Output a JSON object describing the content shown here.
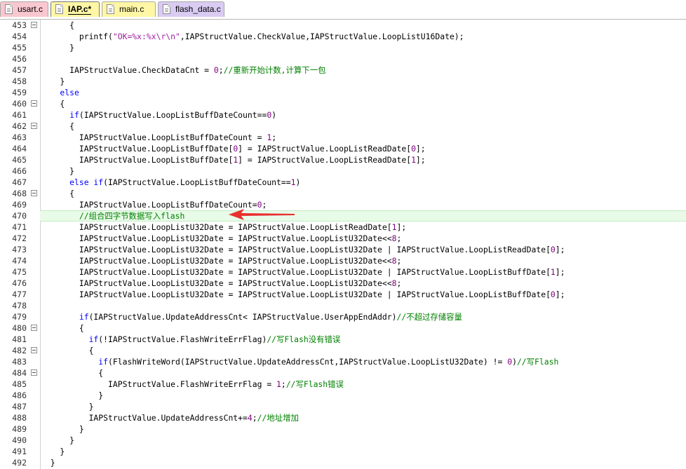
{
  "tabs": [
    {
      "label": "usart.c",
      "color": "#f9c7cf",
      "active": false
    },
    {
      "label": "IAP.c*",
      "color": "#fff6a6",
      "active": true
    },
    {
      "label": "main.c",
      "color": "#fff6a6",
      "active": false
    },
    {
      "label": "flash_data.c",
      "color": "#d9cbf2",
      "active": false
    }
  ],
  "lines": [
    {
      "num": "453",
      "fold": true,
      "code": [
        [
          "",
          "      {"
        ]
      ]
    },
    {
      "num": "454",
      "fold": false,
      "code": [
        [
          "",
          "        printf("
        ],
        [
          "str",
          "\"OK=%x:%x\\r\\n\""
        ],
        [
          "",
          ",IAPStructValue.CheckValue,IAPStructValue.LoopListU16Date);"
        ]
      ]
    },
    {
      "num": "455",
      "fold": false,
      "code": [
        [
          "",
          "      }"
        ]
      ]
    },
    {
      "num": "456",
      "fold": false,
      "code": []
    },
    {
      "num": "457",
      "fold": false,
      "code": [
        [
          "",
          "      IAPStructValue.CheckDataCnt = "
        ],
        [
          "num",
          "0"
        ],
        [
          "",
          ";"
        ],
        [
          "cm",
          "//重新开始计数,计算下一包"
        ]
      ]
    },
    {
      "num": "458",
      "fold": false,
      "code": [
        [
          "",
          "    }"
        ]
      ]
    },
    {
      "num": "459",
      "fold": false,
      "code": [
        [
          "kw",
          "    else"
        ]
      ]
    },
    {
      "num": "460",
      "fold": true,
      "code": [
        [
          "",
          "    {"
        ]
      ]
    },
    {
      "num": "461",
      "fold": false,
      "code": [
        [
          "kw",
          "      if"
        ],
        [
          "",
          "(IAPStructValue.LoopListBuffDateCount=="
        ],
        [
          "num",
          "0"
        ],
        [
          "",
          ")"
        ]
      ]
    },
    {
      "num": "462",
      "fold": true,
      "code": [
        [
          "",
          "      {"
        ]
      ]
    },
    {
      "num": "463",
      "fold": false,
      "code": [
        [
          "",
          "        IAPStructValue.LoopListBuffDateCount = "
        ],
        [
          "num",
          "1"
        ],
        [
          "",
          ";"
        ]
      ]
    },
    {
      "num": "464",
      "fold": false,
      "code": [
        [
          "",
          "        IAPStructValue.LoopListBuffDate["
        ],
        [
          "num",
          "0"
        ],
        [
          "",
          "] = IAPStructValue.LoopListReadDate["
        ],
        [
          "num",
          "0"
        ],
        [
          "",
          "];"
        ]
      ]
    },
    {
      "num": "465",
      "fold": false,
      "code": [
        [
          "",
          "        IAPStructValue.LoopListBuffDate["
        ],
        [
          "num",
          "1"
        ],
        [
          "",
          "] = IAPStructValue.LoopListReadDate["
        ],
        [
          "num",
          "1"
        ],
        [
          "",
          "];"
        ]
      ]
    },
    {
      "num": "466",
      "fold": false,
      "code": [
        [
          "",
          "      }"
        ]
      ]
    },
    {
      "num": "467",
      "fold": false,
      "code": [
        [
          "kw",
          "      else if"
        ],
        [
          "",
          "(IAPStructValue.LoopListBuffDateCount=="
        ],
        [
          "num",
          "1"
        ],
        [
          "",
          ")"
        ]
      ]
    },
    {
      "num": "468",
      "fold": true,
      "code": [
        [
          "",
          "      {"
        ]
      ]
    },
    {
      "num": "469",
      "fold": false,
      "code": [
        [
          "",
          "        IAPStructValue.LoopListBuffDateCount="
        ],
        [
          "num",
          "0"
        ],
        [
          "",
          ";"
        ]
      ]
    },
    {
      "num": "470",
      "fold": false,
      "hl": true,
      "code": [
        [
          "cm",
          "        //组合四字节数据写入flash"
        ]
      ]
    },
    {
      "num": "471",
      "fold": false,
      "code": [
        [
          "",
          "        IAPStructValue.LoopListU32Date = IAPStructValue.LoopListReadDate["
        ],
        [
          "num",
          "1"
        ],
        [
          "",
          "];"
        ]
      ]
    },
    {
      "num": "472",
      "fold": false,
      "code": [
        [
          "",
          "        IAPStructValue.LoopListU32Date = IAPStructValue.LoopListU32Date<<"
        ],
        [
          "num",
          "8"
        ],
        [
          "",
          ";"
        ]
      ]
    },
    {
      "num": "473",
      "fold": false,
      "code": [
        [
          "",
          "        IAPStructValue.LoopListU32Date = IAPStructValue.LoopListU32Date | IAPStructValue.LoopListReadDate["
        ],
        [
          "num",
          "0"
        ],
        [
          "",
          "];"
        ]
      ]
    },
    {
      "num": "474",
      "fold": false,
      "code": [
        [
          "",
          "        IAPStructValue.LoopListU32Date = IAPStructValue.LoopListU32Date<<"
        ],
        [
          "num",
          "8"
        ],
        [
          "",
          ";"
        ]
      ]
    },
    {
      "num": "475",
      "fold": false,
      "code": [
        [
          "",
          "        IAPStructValue.LoopListU32Date = IAPStructValue.LoopListU32Date | IAPStructValue.LoopListBuffDate["
        ],
        [
          "num",
          "1"
        ],
        [
          "",
          "];"
        ]
      ]
    },
    {
      "num": "476",
      "fold": false,
      "code": [
        [
          "",
          "        IAPStructValue.LoopListU32Date = IAPStructValue.LoopListU32Date<<"
        ],
        [
          "num",
          "8"
        ],
        [
          "",
          ";"
        ]
      ]
    },
    {
      "num": "477",
      "fold": false,
      "code": [
        [
          "",
          "        IAPStructValue.LoopListU32Date = IAPStructValue.LoopListU32Date | IAPStructValue.LoopListBuffDate["
        ],
        [
          "num",
          "0"
        ],
        [
          "",
          "];"
        ]
      ]
    },
    {
      "num": "478",
      "fold": false,
      "code": []
    },
    {
      "num": "479",
      "fold": false,
      "code": [
        [
          "kw",
          "        if"
        ],
        [
          "",
          "(IAPStructValue.UpdateAddressCnt< IAPStructValue.UserAppEndAddr)"
        ],
        [
          "cm",
          "//不超过存储容量"
        ]
      ]
    },
    {
      "num": "480",
      "fold": true,
      "code": [
        [
          "",
          "        {"
        ]
      ]
    },
    {
      "num": "481",
      "fold": false,
      "code": [
        [
          "kw",
          "          if"
        ],
        [
          "",
          "(!IAPStructValue.FlashWriteErrFlag)"
        ],
        [
          "cm",
          "//写Flash没有错误"
        ]
      ]
    },
    {
      "num": "482",
      "fold": true,
      "code": [
        [
          "",
          "          {"
        ]
      ]
    },
    {
      "num": "483",
      "fold": false,
      "code": [
        [
          "kw",
          "            if"
        ],
        [
          "",
          "(FlashWriteWord(IAPStructValue.UpdateAddressCnt,IAPStructValue.LoopListU32Date) != "
        ],
        [
          "num",
          "0"
        ],
        [
          "",
          ")"
        ],
        [
          "cm",
          "//写Flash"
        ]
      ]
    },
    {
      "num": "484",
      "fold": true,
      "code": [
        [
          "",
          "            {"
        ]
      ]
    },
    {
      "num": "485",
      "fold": false,
      "code": [
        [
          "",
          "              IAPStructValue.FlashWriteErrFlag = "
        ],
        [
          "num",
          "1"
        ],
        [
          "",
          ";"
        ],
        [
          "cm",
          "//写Flash错误"
        ]
      ]
    },
    {
      "num": "486",
      "fold": false,
      "code": [
        [
          "",
          "            }"
        ]
      ]
    },
    {
      "num": "487",
      "fold": false,
      "code": [
        [
          "",
          "          }"
        ]
      ]
    },
    {
      "num": "488",
      "fold": false,
      "code": [
        [
          "",
          "          IAPStructValue.UpdateAddressCnt+="
        ],
        [
          "num",
          "4"
        ],
        [
          "",
          ";"
        ],
        [
          "cm",
          "//地址增加"
        ]
      ]
    },
    {
      "num": "489",
      "fold": false,
      "code": [
        [
          "",
          "        }"
        ]
      ]
    },
    {
      "num": "490",
      "fold": false,
      "code": [
        [
          "",
          "      }"
        ]
      ]
    },
    {
      "num": "491",
      "fold": false,
      "code": [
        [
          "",
          "    }"
        ]
      ]
    },
    {
      "num": "492",
      "fold": false,
      "code": [
        [
          "",
          "  }"
        ]
      ]
    }
  ],
  "colors": {
    "keyword": "#0000ff",
    "string": "#a020a0",
    "number": "#800080",
    "comment": "#008000",
    "highlight": "#e8fbe8",
    "arrow": "#e83030"
  }
}
